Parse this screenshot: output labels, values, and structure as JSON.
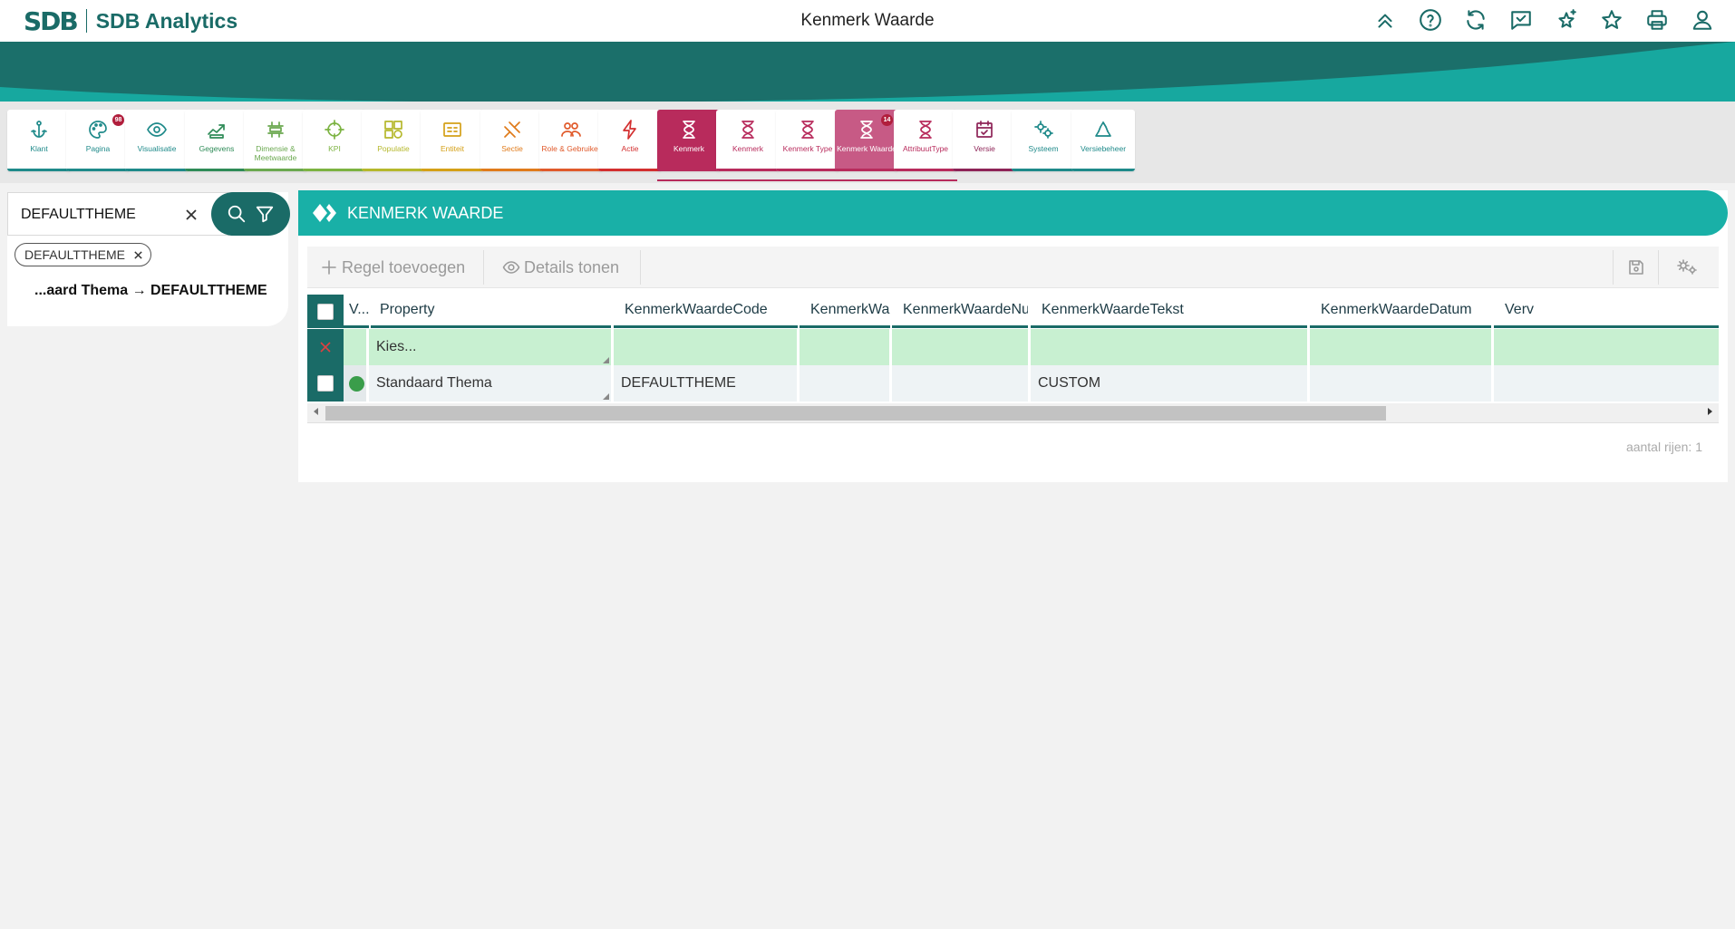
{
  "app": {
    "logo_mark": "SDB",
    "name": "SDB Analytics",
    "page_title": "Kenmerk Waarde"
  },
  "top_icons": [
    "chevrons-up-icon",
    "help-icon",
    "refresh-icon",
    "feedback-icon",
    "sparkle-star-icon",
    "star-icon",
    "print-icon",
    "user-icon"
  ],
  "ribbon": [
    {
      "label": "Klant",
      "color": "#1f8a8a",
      "icon": "anchor-icon"
    },
    {
      "label": "Pagina",
      "color": "#1f8a8a",
      "icon": "palette-icon",
      "badge": "98"
    },
    {
      "label": "Visualisatie",
      "color": "#1f8a8a",
      "icon": "eye-icon"
    },
    {
      "label": "Gegevens",
      "color": "#2e8b57",
      "icon": "data-icon"
    },
    {
      "label": "Dimensie & Meetwaarde",
      "color": "#6aa84f",
      "icon": "dimension-icon"
    },
    {
      "label": "KPI",
      "color": "#7cb342",
      "icon": "target-icon"
    },
    {
      "label": "Populatie",
      "color": "#b5b82c",
      "icon": "population-icon"
    },
    {
      "label": "Entiteit",
      "color": "#d4a017",
      "icon": "entity-icon"
    },
    {
      "label": "Sectie",
      "color": "#e07b1b",
      "icon": "section-icon"
    },
    {
      "label": "Role & Gebruiker",
      "color": "#e05a2b",
      "icon": "users-icon"
    },
    {
      "label": "Actie",
      "color": "#d32f2f",
      "icon": "lightning-icon"
    },
    {
      "label": "Kenmerk",
      "color": "#b82b5c",
      "icon": "hourglass-icon",
      "active": true
    },
    {
      "label": "Kenmerk",
      "color": "#b82b5c",
      "icon": "hourglass-icon"
    },
    {
      "label": "Kenmerk Type",
      "color": "#b82b5c",
      "icon": "hourglass-icon"
    },
    {
      "label": "Kenmerk Waarde",
      "color": "#b82b5c",
      "icon": "hourglass-icon",
      "selected": true,
      "badge": "14"
    },
    {
      "label": "AttribuutType",
      "color": "#b82b5c",
      "icon": "hourglass-icon"
    },
    {
      "label": "Versie",
      "color": "#8e2457",
      "icon": "calendar-check-icon"
    },
    {
      "label": "Systeem",
      "color": "#1f8a8a",
      "icon": "gears-icon"
    },
    {
      "label": "Versiebeheer",
      "color": "#1f8a8a",
      "icon": "recycle-icon"
    }
  ],
  "search": {
    "value": "DEFAULTTHEME",
    "chip": "DEFAULTTHEME",
    "breadcrumb": "...aard Thema → DEFAULTTHEME"
  },
  "main": {
    "title": "KENMERK WAARDE",
    "toolbar": {
      "add_row": "Regel toevoegen",
      "show_details": "Details tonen"
    },
    "columns": [
      "V...",
      "Property",
      "KenmerkWaardeCode",
      "KenmerkWa...",
      "KenmerkWaardeNum",
      "KenmerkWaardeTekst",
      "KenmerkWaardeDatum",
      "Verv"
    ],
    "filter_row": {
      "property_placeholder": "Kies..."
    },
    "rows": [
      {
        "status_color": "#3a9d4a",
        "property": "Standaard Thema",
        "code": "DEFAULTTHEME",
        "wa": "",
        "num": "",
        "tekst": "CUSTOM",
        "datum": "",
        "verv": ""
      }
    ],
    "row_count_text": "aantal rijen: 1"
  },
  "colors": {
    "brand_dark": "#1a6b67",
    "brand_teal": "#19b0a7",
    "filter_green": "#c8f0d1",
    "accent_kenmerk": "#b82b5c"
  }
}
